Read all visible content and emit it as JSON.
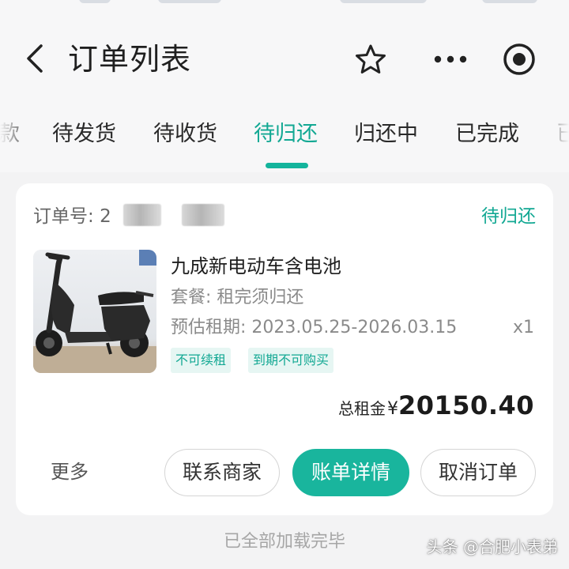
{
  "header": {
    "title": "订单列表",
    "icons": [
      "back-arrow-icon",
      "star-icon",
      "more-dots-icon",
      "target-icon"
    ]
  },
  "tabs": [
    {
      "label": "款",
      "active": false
    },
    {
      "label": "待发货",
      "active": false
    },
    {
      "label": "待收货",
      "active": false
    },
    {
      "label": "待归还",
      "active": true
    },
    {
      "label": "归还中",
      "active": false
    },
    {
      "label": "已完成",
      "active": false
    },
    {
      "label": "已",
      "active": false
    }
  ],
  "order": {
    "number_label": "订单号:",
    "number_visible": "2",
    "status": "待归还",
    "product": {
      "name": "九成新电动车含电池",
      "package_label": "套餐:",
      "package_value": "租完须归还",
      "period_label": "预估租期:",
      "period_value": "2023.05.25-2026.03.15",
      "quantity": "x1",
      "tags": [
        "不可续租",
        "到期不可购买"
      ]
    },
    "total_label": "总租金",
    "total_currency": "¥",
    "total_amount": "20150.40",
    "actions": {
      "more": "更多",
      "contact": "联系商家",
      "bill": "账单详情",
      "cancel": "取消订单"
    }
  },
  "footer": {
    "loaded_text": "已全部加载完毕"
  },
  "watermark": "头条 @合肥小表弟",
  "colors": {
    "accent": "#19b59d",
    "accent_text": "#12a893",
    "tag_bg": "#e6f6f3",
    "background": "#f3f3f4"
  }
}
